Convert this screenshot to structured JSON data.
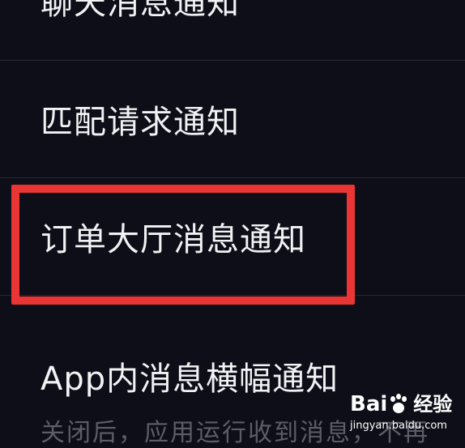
{
  "settings": {
    "items": [
      {
        "label": "聊天消息通知"
      },
      {
        "label": "匹配请求通知"
      },
      {
        "label": "订单大厅消息通知"
      },
      {
        "label": "App内消息横幅通知",
        "description": "关闭后，应用运行收到消息，不再"
      }
    ]
  },
  "watermark": {
    "brand_left": "Bai",
    "brand_right": "经验",
    "url": "jingyan.baidu.com"
  },
  "colors": {
    "background": "#0d0e17",
    "text": "#f2f2f4",
    "highlight": "#ea3535",
    "divider": "#262733"
  }
}
